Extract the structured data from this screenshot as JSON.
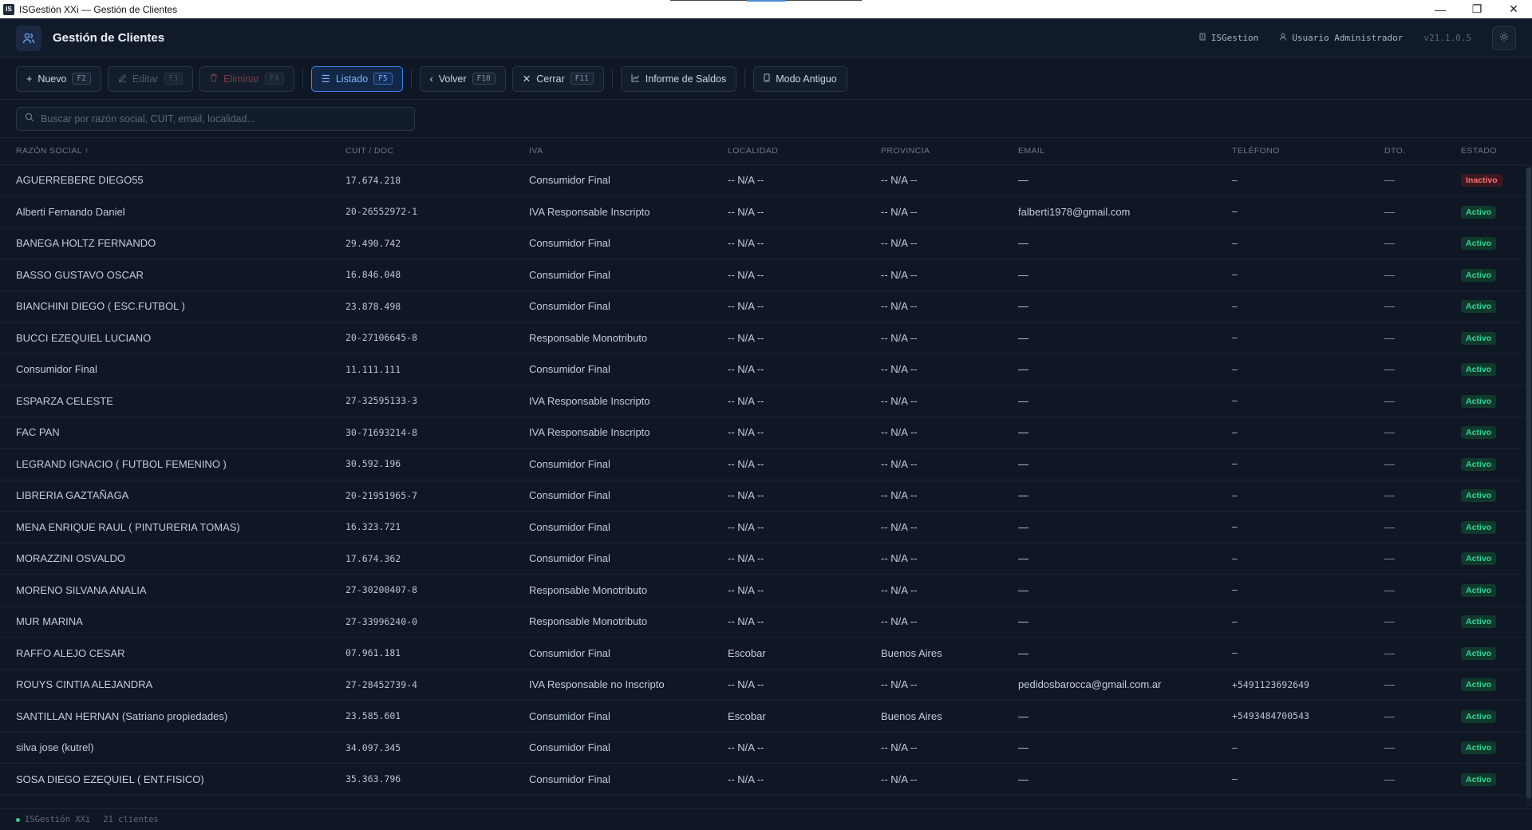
{
  "window": {
    "title": "ISGestión XXi — Gestión de Clientes",
    "app_icon": "IS"
  },
  "header": {
    "title": "Gestión de Clientes",
    "company": "ISGestion",
    "user": "Usuario Administrador",
    "version": "v21.1.0.5"
  },
  "toolbar": {
    "nuevo": {
      "label": "Nuevo",
      "key": "F2"
    },
    "editar": {
      "label": "Editar",
      "key": "F3"
    },
    "eliminar": {
      "label": "Eliminar",
      "key": "F4"
    },
    "listado": {
      "label": "Listado",
      "key": "F5"
    },
    "volver": {
      "label": "Volver",
      "key": "F10"
    },
    "cerrar": {
      "label": "Cerrar",
      "key": "F11"
    },
    "informe": {
      "label": "Informe de Saldos"
    },
    "modo": {
      "label": "Modo Antiguo"
    }
  },
  "search": {
    "placeholder": "Buscar por razón social, CUIT, email, localidad..."
  },
  "table": {
    "headers": {
      "razon": "RAZÓN SOCIAL ↑",
      "cuit": "CUIT / DOC",
      "iva": "IVA",
      "localidad": "LOCALIDAD",
      "provincia": "PROVINCIA",
      "email": "EMAIL",
      "telefono": "TELÉFONO",
      "dto": "DTO.",
      "estado": "ESTADO"
    },
    "rows": [
      {
        "razon": "AGUERREBERE DIEGO55",
        "cuit": "17.674.218",
        "iva": "Consumidor Final",
        "localidad": "-- N/A --",
        "provincia": "-- N/A --",
        "email": "—",
        "telefono": "–",
        "dto": "—",
        "estado": "Inactivo"
      },
      {
        "razon": "Alberti Fernando Daniel",
        "cuit": "20-26552972-1",
        "iva": "IVA Responsable Inscripto",
        "localidad": "-- N/A --",
        "provincia": "-- N/A --",
        "email": "falberti1978@gmail.com",
        "telefono": "–",
        "dto": "—",
        "estado": "Activo"
      },
      {
        "razon": "BANEGA HOLTZ FERNANDO",
        "cuit": "29.490.742",
        "iva": "Consumidor Final",
        "localidad": "-- N/A --",
        "provincia": "-- N/A --",
        "email": "—",
        "telefono": "–",
        "dto": "—",
        "estado": "Activo"
      },
      {
        "razon": "BASSO GUSTAVO OSCAR",
        "cuit": "16.846.048",
        "iva": "Consumidor Final",
        "localidad": "-- N/A --",
        "provincia": "-- N/A --",
        "email": "—",
        "telefono": "–",
        "dto": "—",
        "estado": "Activo"
      },
      {
        "razon": "BIANCHINI DIEGO ( ESC.FUTBOL )",
        "cuit": "23.878.498",
        "iva": "Consumidor Final",
        "localidad": "-- N/A --",
        "provincia": "-- N/A --",
        "email": "—",
        "telefono": "–",
        "dto": "—",
        "estado": "Activo"
      },
      {
        "razon": "BUCCI EZEQUIEL LUCIANO",
        "cuit": "20-27106645-8",
        "iva": "Responsable Monotributo",
        "localidad": "-- N/A --",
        "provincia": "-- N/A --",
        "email": "—",
        "telefono": "–",
        "dto": "—",
        "estado": "Activo"
      },
      {
        "razon": "Consumidor Final",
        "cuit": "11.111.111",
        "iva": "Consumidor Final",
        "localidad": "-- N/A --",
        "provincia": "-- N/A --",
        "email": "—",
        "telefono": "–",
        "dto": "—",
        "estado": "Activo"
      },
      {
        "razon": "ESPARZA CELESTE",
        "cuit": "27-32595133-3",
        "iva": "IVA Responsable Inscripto",
        "localidad": "-- N/A --",
        "provincia": "-- N/A --",
        "email": "—",
        "telefono": "–",
        "dto": "—",
        "estado": "Activo"
      },
      {
        "razon": "FAC PAN",
        "cuit": "30-71693214-8",
        "iva": "IVA Responsable Inscripto",
        "localidad": "-- N/A --",
        "provincia": "-- N/A --",
        "email": "—",
        "telefono": "–",
        "dto": "—",
        "estado": "Activo"
      },
      {
        "razon": "LEGRAND IGNACIO ( FUTBOL FEMENINO )",
        "cuit": "30.592.196",
        "iva": "Consumidor Final",
        "localidad": "-- N/A --",
        "provincia": "-- N/A --",
        "email": "—",
        "telefono": "–",
        "dto": "—",
        "estado": "Activo"
      },
      {
        "razon": "LIBRERIA GAZTAÑAGA",
        "cuit": "20-21951965-7",
        "iva": "Consumidor Final",
        "localidad": "-- N/A --",
        "provincia": "-- N/A --",
        "email": "—",
        "telefono": "–",
        "dto": "—",
        "estado": "Activo"
      },
      {
        "razon": "MENA ENRIQUE RAUL ( PINTURERIA TOMAS)",
        "cuit": "16.323.721",
        "iva": "Consumidor Final",
        "localidad": "-- N/A --",
        "provincia": "-- N/A --",
        "email": "—",
        "telefono": "–",
        "dto": "—",
        "estado": "Activo"
      },
      {
        "razon": "MORAZZINI OSVALDO",
        "cuit": "17.674.362",
        "iva": "Consumidor Final",
        "localidad": "-- N/A --",
        "provincia": "-- N/A --",
        "email": "—",
        "telefono": "–",
        "dto": "—",
        "estado": "Activo"
      },
      {
        "razon": "MORENO SILVANA ANALIA",
        "cuit": "27-30200407-8",
        "iva": "Responsable Monotributo",
        "localidad": "-- N/A --",
        "provincia": "-- N/A --",
        "email": "—",
        "telefono": "–",
        "dto": "—",
        "estado": "Activo"
      },
      {
        "razon": "MUR MARINA",
        "cuit": "27-33996240-0",
        "iva": "Responsable Monotributo",
        "localidad": "-- N/A --",
        "provincia": "-- N/A --",
        "email": "—",
        "telefono": "–",
        "dto": "—",
        "estado": "Activo"
      },
      {
        "razon": "RAFFO ALEJO CESAR",
        "cuit": "07.961.181",
        "iva": "Consumidor Final",
        "localidad": "Escobar",
        "provincia": "Buenos Aires",
        "email": "—",
        "telefono": "–",
        "dto": "—",
        "estado": "Activo"
      },
      {
        "razon": "ROUYS CINTIA ALEJANDRA",
        "cuit": "27-28452739-4",
        "iva": "IVA Responsable no Inscripto",
        "localidad": "-- N/A --",
        "provincia": "-- N/A --",
        "email": "pedidosbarocca@gmail.com.ar",
        "telefono": "+5491123692649",
        "dto": "—",
        "estado": "Activo"
      },
      {
        "razon": "SANTILLAN HERNAN (Satriano propiedades)",
        "cuit": "23.585.601",
        "iva": "Consumidor Final",
        "localidad": "Escobar",
        "provincia": "Buenos Aires",
        "email": "—",
        "telefono": "+5493484700543",
        "dto": "—",
        "estado": "Activo"
      },
      {
        "razon": "silva jose (kutrel)",
        "cuit": "34.097.345",
        "iva": "Consumidor Final",
        "localidad": "-- N/A --",
        "provincia": "-- N/A --",
        "email": "—",
        "telefono": "–",
        "dto": "—",
        "estado": "Activo"
      },
      {
        "razon": "SOSA DIEGO EZEQUIEL ( ENT.FISICO)",
        "cuit": "35.363.796",
        "iva": "Consumidor Final",
        "localidad": "-- N/A --",
        "provincia": "-- N/A --",
        "email": "—",
        "telefono": "–",
        "dto": "—",
        "estado": "Activo"
      }
    ]
  },
  "status": {
    "app": "ISGestión XXi",
    "count": "21 clientes"
  },
  "colors": {
    "accent": "#3b82f6",
    "active": "#34d399",
    "inactive": "#f87171",
    "background": "#0f1724"
  }
}
